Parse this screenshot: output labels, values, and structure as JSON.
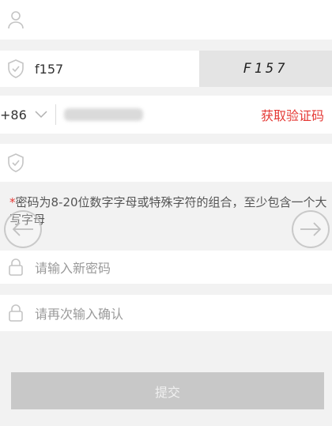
{
  "account": {
    "value_blurred": ""
  },
  "captcha": {
    "input_value": "f157",
    "image_text": "F157"
  },
  "phone": {
    "country_code": "+86",
    "get_code_label": "获取验证码"
  },
  "verify_code": {
    "placeholder": ""
  },
  "hint": {
    "star": "*",
    "text": "密码为8-20位数字字母或特殊字符的组合，至少包含一个大写字母"
  },
  "new_password": {
    "placeholder": "请输入新密码"
  },
  "confirm_password": {
    "placeholder": "请再次输入确认"
  },
  "submit": {
    "label": "提交"
  },
  "colors": {
    "accent_red": "#e53935",
    "button_disabled": "#c8c8c8",
    "background": "#f2f2f2"
  }
}
